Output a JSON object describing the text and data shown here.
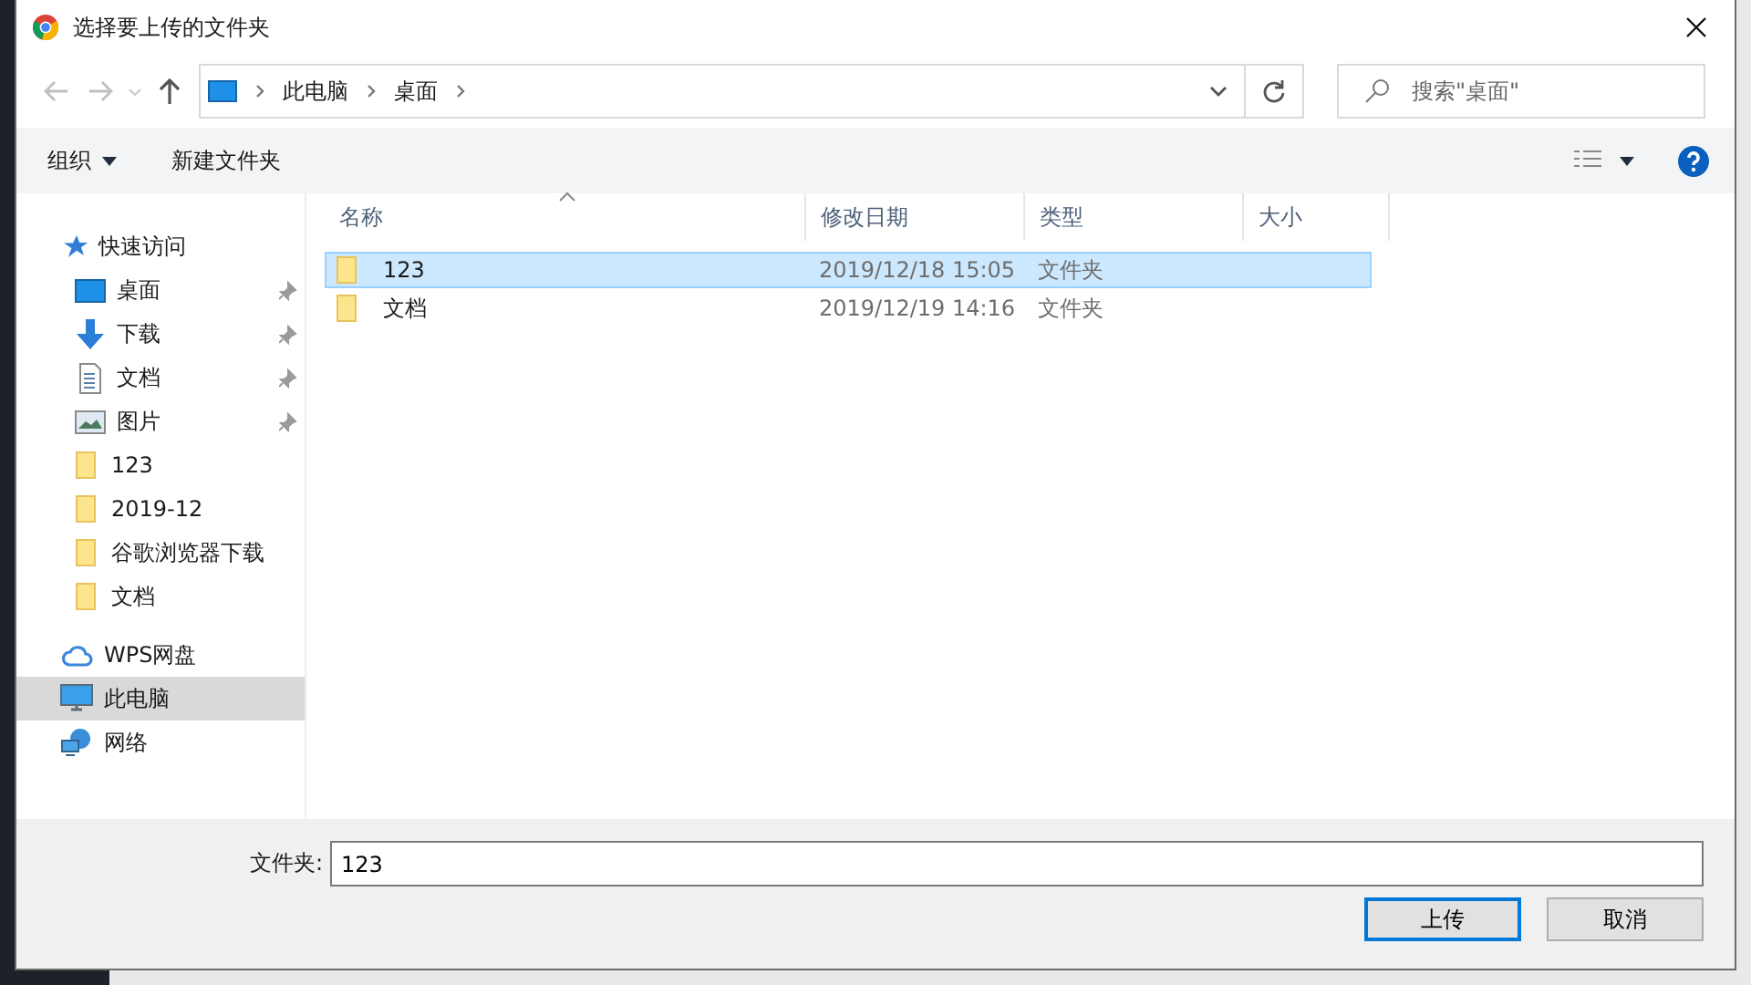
{
  "window": {
    "title": "选择要上传的文件夹"
  },
  "address": {
    "path": [
      "此电脑",
      "桌面"
    ]
  },
  "search": {
    "placeholder": "搜索\"桌面\""
  },
  "toolbar": {
    "organize": "组织",
    "new_folder": "新建文件夹"
  },
  "sidebar": {
    "items": [
      {
        "label": "快速访问",
        "kind": "star",
        "selected": false,
        "children": [
          {
            "label": "桌面",
            "kind": "desktop",
            "pinned": true,
            "selected": false
          },
          {
            "label": "下载",
            "kind": "download",
            "pinned": true,
            "selected": false
          },
          {
            "label": "文档",
            "kind": "document",
            "pinned": true,
            "selected": false
          },
          {
            "label": "图片",
            "kind": "image",
            "pinned": true,
            "selected": false
          },
          {
            "label": "123",
            "kind": "folder",
            "pinned": false,
            "selected": false
          },
          {
            "label": "2019-12",
            "kind": "folder",
            "pinned": false,
            "selected": false
          },
          {
            "label": "谷歌浏览器下载",
            "kind": "folder",
            "pinned": false,
            "selected": false
          },
          {
            "label": "文档",
            "kind": "folder",
            "pinned": false,
            "selected": false
          }
        ]
      },
      {
        "label": "WPS网盘",
        "kind": "cloud",
        "selected": false
      },
      {
        "label": "此电脑",
        "kind": "computer",
        "selected": true
      },
      {
        "label": "网络",
        "kind": "network",
        "selected": false
      }
    ]
  },
  "table": {
    "columns": [
      "名称",
      "修改日期",
      "类型",
      "大小"
    ],
    "rows": [
      {
        "name": "123",
        "modified": "2019/12/18 15:05",
        "type": "文件夹",
        "selected": true
      },
      {
        "name": "文档",
        "modified": "2019/12/19 14:16",
        "type": "文件夹",
        "selected": false
      }
    ]
  },
  "folder_field": {
    "label": "文件夹:",
    "value": "123"
  },
  "buttons": [
    {
      "label": "上传",
      "default": true
    },
    {
      "label": "取消",
      "default": false
    }
  ]
}
